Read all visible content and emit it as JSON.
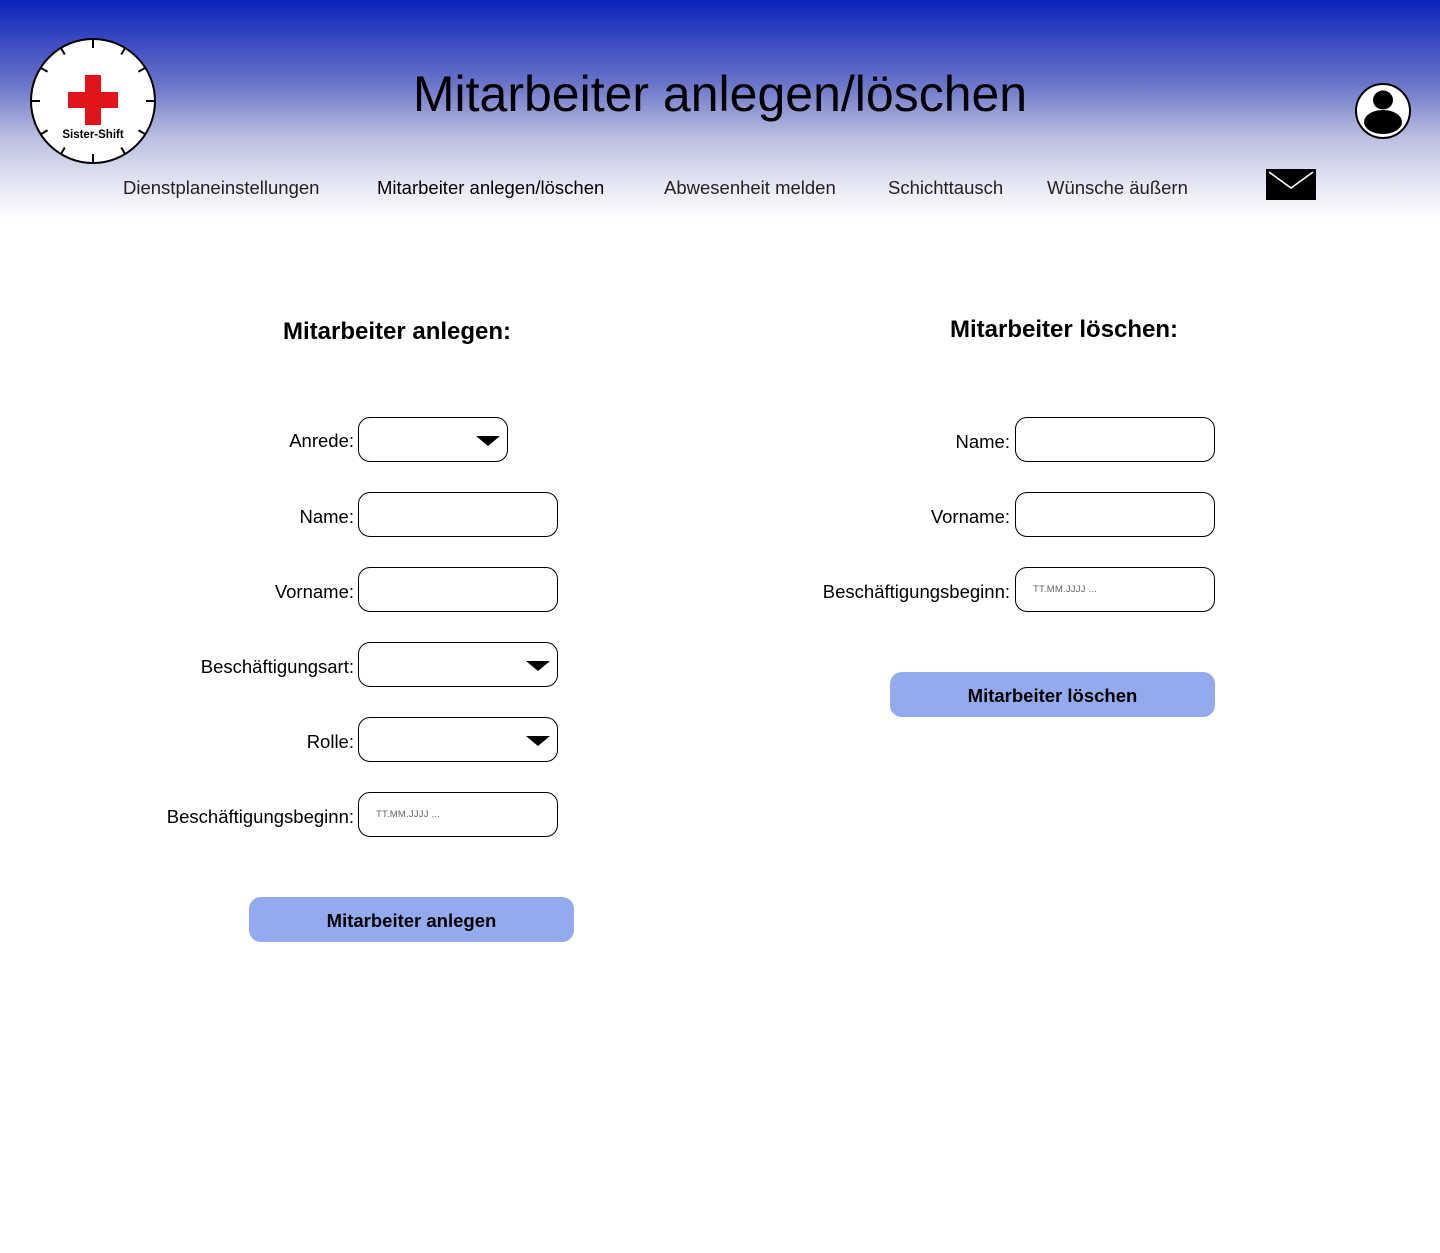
{
  "header": {
    "logo_text": "Sister-Shift",
    "title": "Mitarbeiter anlegen/löschen"
  },
  "nav": {
    "items": [
      {
        "label": "Dienstplaneinstellungen"
      },
      {
        "label": "Mitarbeiter anlegen/löschen",
        "active": true
      },
      {
        "label": "Abwesenheit melden"
      },
      {
        "label": "Schichttausch"
      },
      {
        "label": "Wünsche äußern"
      }
    ]
  },
  "create": {
    "title": "Mitarbeiter anlegen:",
    "anrede_label": "Anrede:",
    "anrede_value": "",
    "name_label": "Name:",
    "name_value": "",
    "vorname_label": "Vorname:",
    "vorname_value": "",
    "beschaeftigungsart_label": "Beschäftigungsart:",
    "beschaeftigungsart_value": "",
    "rolle_label": "Rolle:",
    "rolle_value": "",
    "beginn_label": "Beschäftigungsbeginn:",
    "beginn_placeholder": "TT.MM.JJJJ ...",
    "submit_label": "Mitarbeiter anlegen"
  },
  "delete": {
    "title": "Mitarbeiter löschen:",
    "name_label": "Name:",
    "name_value": "",
    "vorname_label": "Vorname:",
    "vorname_value": "",
    "beginn_label": "Beschäftigungsbeginn:",
    "beginn_placeholder": "TT.MM.JJJJ ...",
    "submit_label": "Mitarbeiter löschen"
  },
  "colors": {
    "header_top": "#0c22bb",
    "button": "#94aaee",
    "logo_cross": "#e3131b"
  },
  "icons": [
    "clock-logo-icon",
    "red-cross-icon",
    "user-avatar-icon",
    "mail-icon",
    "dropdown-caret-icon"
  ]
}
